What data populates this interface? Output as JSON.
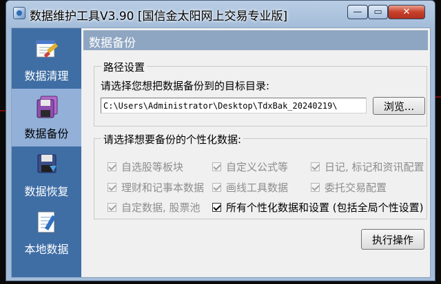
{
  "window": {
    "title": "数据维护工具V3.90 [国信金太阳网上交易专业版]",
    "controls": {
      "minimize": "—",
      "maximize": "▭",
      "close": "✕"
    }
  },
  "sidebar": {
    "items": [
      {
        "label": "数据清理",
        "icon": "clean-data-icon",
        "active": false
      },
      {
        "label": "数据备份",
        "icon": "backup-data-icon",
        "active": true
      },
      {
        "label": "数据恢复",
        "icon": "restore-data-icon",
        "active": false
      },
      {
        "label": "本地数据",
        "icon": "local-data-icon",
        "active": false
      }
    ]
  },
  "main": {
    "header": "数据备份",
    "path_group": {
      "legend": "路径设置",
      "prompt": "请选择您想把数据备份到的目标目录:",
      "path_value": "C:\\Users\\Administrator\\Desktop\\TdxBak_20240219\\",
      "browse_label": "浏览..."
    },
    "data_group": {
      "legend": "请选择想要备份的个性化数据:",
      "checkboxes": [
        {
          "label": "自选股等板块",
          "checked": true,
          "enabled": false
        },
        {
          "label": "自定义公式等",
          "checked": true,
          "enabled": false
        },
        {
          "label": "日记, 标记和资讯配置",
          "checked": true,
          "enabled": false
        },
        {
          "label": "理财和记事本数据",
          "checked": true,
          "enabled": false
        },
        {
          "label": "画线工具数据",
          "checked": true,
          "enabled": false
        },
        {
          "label": "委托交易配置",
          "checked": true,
          "enabled": false
        },
        {
          "label": "自定数据, 股票池",
          "checked": true,
          "enabled": false
        },
        {
          "label": "所有个性化数据和设置 (包括全局个性设置)",
          "checked": true,
          "enabled": true
        }
      ],
      "execute_label": "执行操作"
    }
  }
}
